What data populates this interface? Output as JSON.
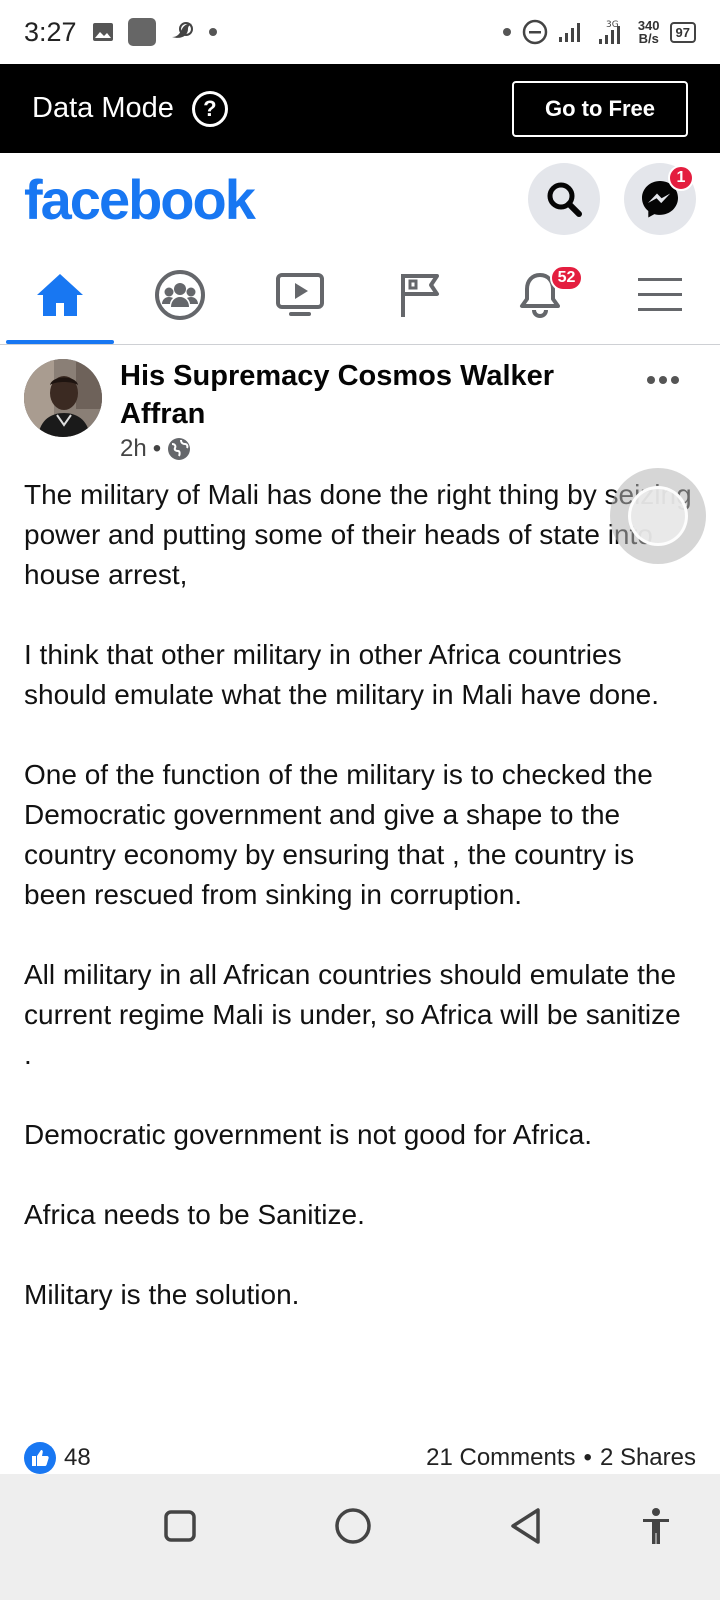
{
  "status_bar": {
    "time": "3:27",
    "speed_value": "340",
    "speed_unit": "B/s",
    "battery": "97"
  },
  "data_mode": {
    "label": "Data Mode",
    "help_glyph": "?",
    "cta_label": "Go to Free"
  },
  "header": {
    "logo": "facebook",
    "messenger_badge": "1",
    "brand_color": "#1877f2"
  },
  "nav": {
    "tabs": [
      {
        "name": "home",
        "icon": "home-icon",
        "active": true
      },
      {
        "name": "groups",
        "icon": "groups-icon",
        "active": false
      },
      {
        "name": "watch",
        "icon": "video-icon",
        "active": false
      },
      {
        "name": "pages",
        "icon": "flag-icon",
        "active": false
      },
      {
        "name": "notifications",
        "icon": "bell-icon",
        "active": false
      },
      {
        "name": "menu",
        "icon": "menu-icon",
        "active": false
      }
    ],
    "notifications_badge": "52"
  },
  "post": {
    "author_line1": "His  Supremacy   Cosmos Walker",
    "author_line2": "Affran",
    "time": "2h",
    "privacy_icon": "globe-icon",
    "paragraphs": [
      "The military of Mali has done the right thing by seizing power and putting some of their heads of state into house arrest,",
      "I think that other military in other Africa countries should emulate what the military in Mali have done.",
      "One of the function of the military is to checked the  Democratic  government and give a shape to the country economy by ensuring that  , the  country is been rescued  from sinking in corruption.",
      "All military in all African countries should emulate the current  regime Mali is under,  so Africa will be sanitize .",
      "Democratic government is not good for Africa.",
      "Africa needs to be Sanitize.",
      "Military is the  solution."
    ],
    "likes": "48",
    "comments": "21 Comments",
    "separator": "•",
    "shares": "2 Shares"
  }
}
